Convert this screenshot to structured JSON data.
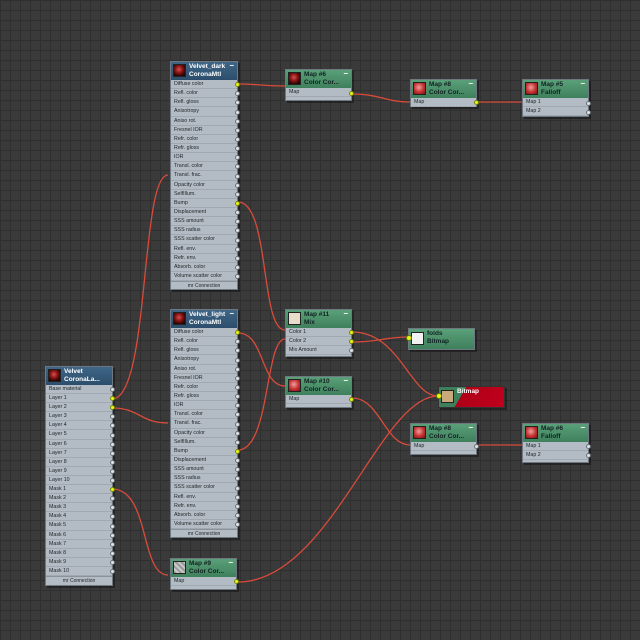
{
  "colors": {
    "wire": "#d84b3a",
    "socket_connected": "#e6f51a",
    "material_header": "#35597a",
    "map_header": "#4e9470",
    "background": "#3a3a3a"
  },
  "nodes": {
    "velvet_blend": {
      "name": "Velvet",
      "type": "CoronaLa...",
      "thumb": "dark-sphere",
      "slots": [
        "Base material",
        "Layer 1",
        "Layer 2",
        "Layer 3",
        "Layer 4",
        "Layer 5",
        "Layer 6",
        "Layer 7",
        "Layer 8",
        "Layer 9",
        "Layer 10",
        "Mask 1",
        "Mask 2",
        "Mask 3",
        "Mask 4",
        "Mask 5",
        "Mask 6",
        "Mask 7",
        "Mask 8",
        "Mask 9",
        "Mask 10"
      ],
      "footer": "mr Connection"
    },
    "velvet_dark": {
      "name": "Velvet_dark",
      "type": "CoronaMtl",
      "thumb": "dark-sphere",
      "slots": [
        "Diffuse color",
        "Refl. color",
        "Refl. gloss",
        "Anisotropy",
        "Aniso rot.",
        "Fresnel IOR",
        "Refr. color",
        "Refr. gloss",
        "IOR",
        "Transl. color",
        "Transl. frac.",
        "Opacity color",
        "SelfIllum.",
        "Bump",
        "Displacement",
        "SSS amount",
        "SSS radius",
        "SSS scatter color",
        "Refl. env.",
        "Refr. env.",
        "Absorb. color",
        "Volume scatter color"
      ],
      "footer": "mr Connection"
    },
    "velvet_light": {
      "name": "Velvet_light",
      "type": "CoronaMtl",
      "thumb": "dark-sphere",
      "slots": [
        "Diffuse color",
        "Refl. color",
        "Refl. gloss",
        "Anisotropy",
        "Aniso rot.",
        "Fresnel IOR",
        "Refr. color",
        "Refr. gloss",
        "IOR",
        "Transl. color",
        "Transl. frac.",
        "Opacity color",
        "SelfIllum.",
        "Bump",
        "Displacement",
        "SSS amount",
        "SSS radius",
        "SSS scatter color",
        "Refl. env.",
        "Refr. env.",
        "Absorb. color",
        "Volume scatter color"
      ],
      "footer": "mr Connection"
    },
    "map6": {
      "name": "Map #6",
      "type": "Color Cor...",
      "slots": [
        "Map"
      ]
    },
    "map8_top": {
      "name": "Map #8",
      "type": "Color Cor...",
      "slots": [
        "Map"
      ]
    },
    "map5_top": {
      "name": "Map #5",
      "type": "Falloff",
      "slots": [
        "Map 1",
        "Map 2"
      ]
    },
    "map11": {
      "name": "Map #11",
      "type": "Mix",
      "slots": [
        "Color 1",
        "Color 2",
        "Mix Amount"
      ]
    },
    "map10": {
      "name": "Map #10",
      "type": "Color Cor...",
      "slots": [
        "Map"
      ]
    },
    "folds": {
      "name": "folds",
      "type": "Bitmap"
    },
    "bitmap_red": {
      "name": "",
      "type": "Bitmap"
    },
    "map8_mid": {
      "name": "Map #8",
      "type": "Color Cor...",
      "slots": [
        "Map"
      ]
    },
    "map6_falloff": {
      "name": "Map #6",
      "type": "Falloff",
      "slots": [
        "Map 1",
        "Map 2"
      ]
    },
    "map9": {
      "name": "Map #9",
      "type": "Color Cor...",
      "slots": [
        "Map"
      ]
    }
  }
}
